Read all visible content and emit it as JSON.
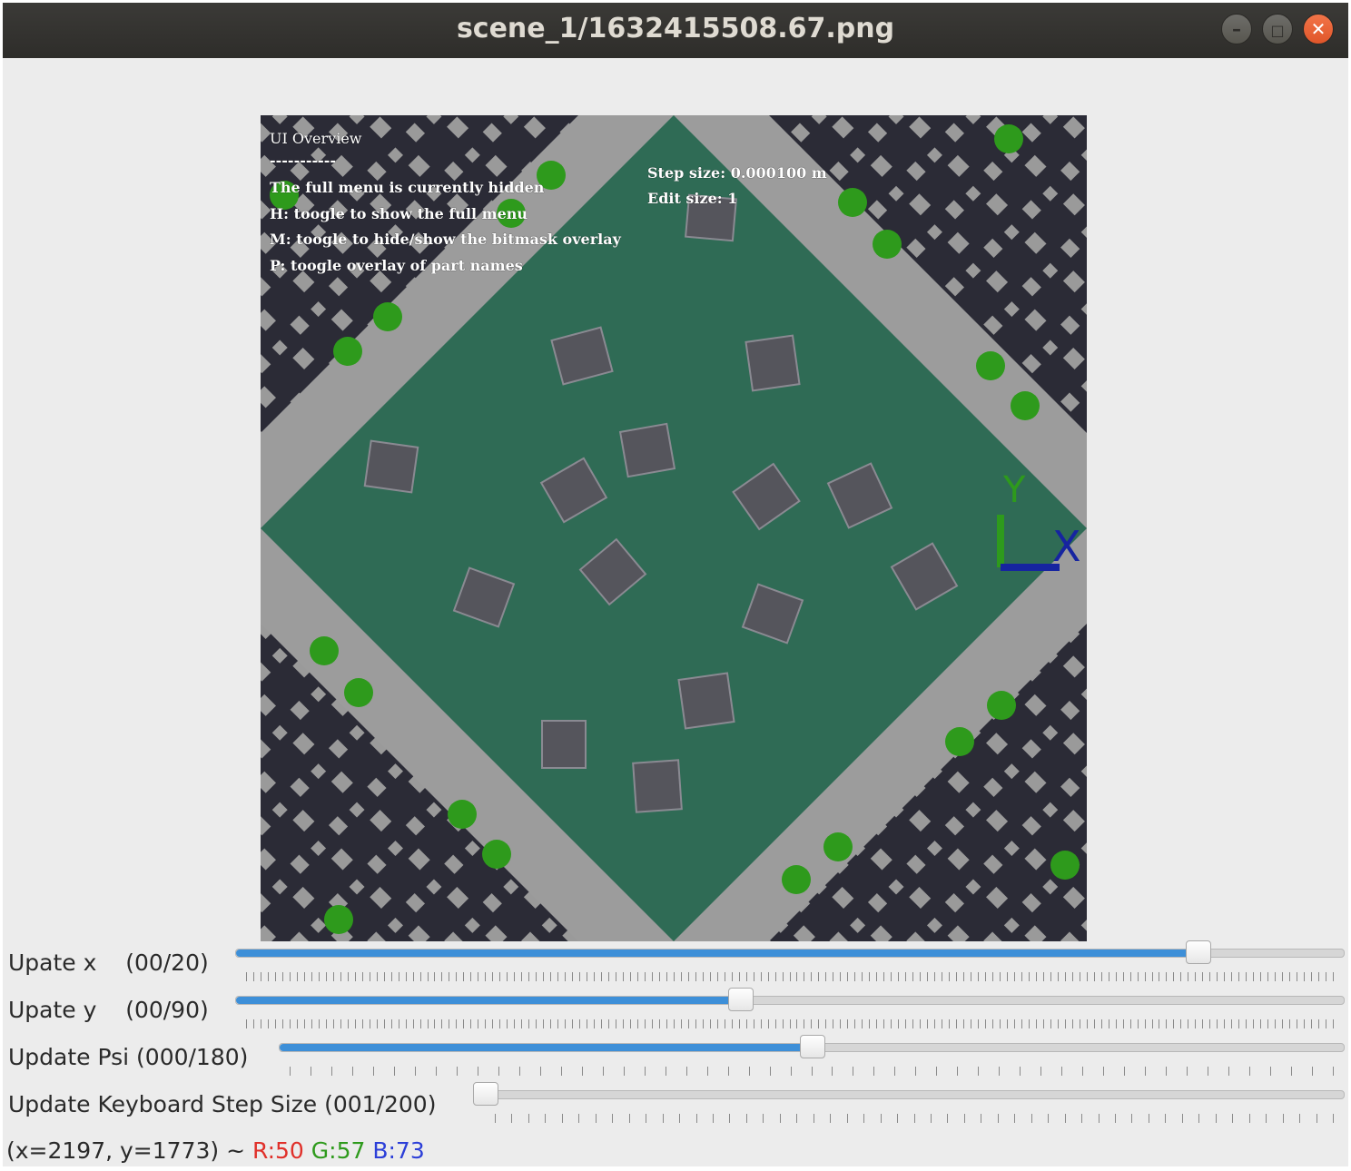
{
  "window": {
    "title": "scene_1/1632415508.67.png",
    "buttons": [
      "minimize",
      "maximize",
      "close"
    ]
  },
  "overlay": {
    "lines": [
      "UI Overview",
      "-----------",
      "The full menu is currently hidden",
      "H: toogle to show the full menu",
      "M: toogle to hide/show the bitmask overlay",
      "P: toogle overlay of part names"
    ],
    "step_size": "Step size: 0.000100 m",
    "edit_size": "Edit size: 1",
    "axis_x": "X",
    "axis_y": "Y"
  },
  "sliders": [
    {
      "label": "Upate x    (00/20)",
      "value": 0.868
    },
    {
      "label": "Upate y    (00/90)",
      "value": 0.455
    },
    {
      "label": "Update Psi (000/180)",
      "value": 0.5
    },
    {
      "label": "Update Keyboard Step Size (001/200)",
      "value": 0.0
    }
  ],
  "status": {
    "coords": "(x=2197, y=1773) ~ ",
    "r": "R:50",
    "g": "G:57",
    "b": "B:73"
  },
  "colors": {
    "titlebar": "#2e2d2a",
    "accent": "#3d8fd8",
    "mat": "#2f6b55",
    "marker_dot": "#2e9a1c",
    "r": "#e0302a",
    "g": "#2e9a1c",
    "b": "#2c3fd8"
  }
}
